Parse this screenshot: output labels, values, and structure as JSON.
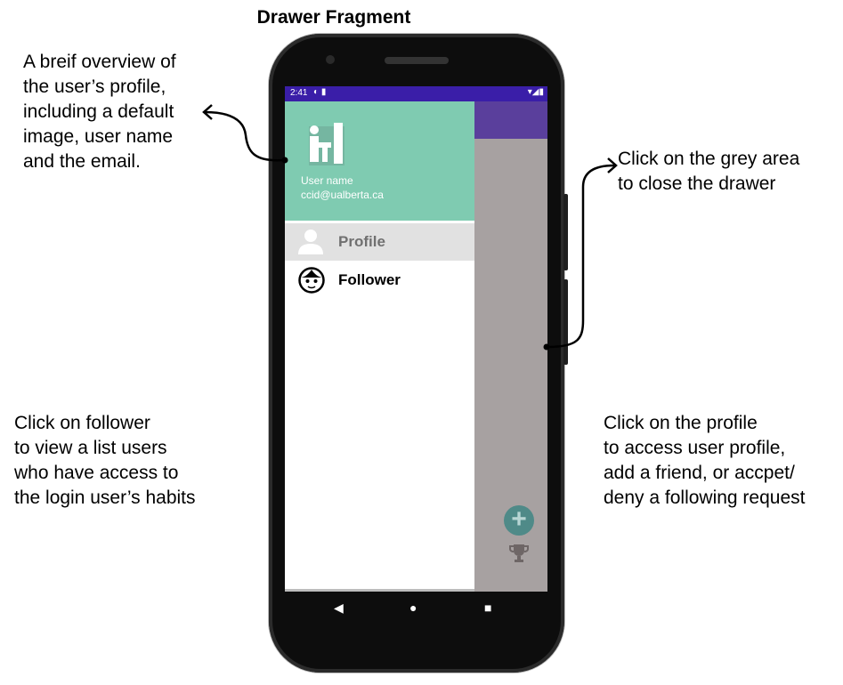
{
  "title": "Drawer Fragment",
  "annotations": {
    "top_left": "A breif overview of\nthe user’s profile,\nincluding a default\nimage, user name\nand the email.",
    "top_right": "Click on the grey area\nto close the drawer",
    "bottom_left": "Click on follower\nto view a list users\nwho have access to\nthe login user’s habits",
    "bottom_right": "Click on the profile\nto access user profile,\nadd a friend, or accpet/\ndeny a following request"
  },
  "status_bar": {
    "time": "2:41",
    "left_icons": "◐ ▮",
    "right_icons": "▾◢▮"
  },
  "drawer": {
    "user_name": "User name",
    "email": "ccid@ualberta.ca",
    "menu": [
      {
        "label": "Profile",
        "icon": "person-icon",
        "selected": true
      },
      {
        "label": "Follower",
        "icon": "face-icon",
        "selected": false
      }
    ]
  },
  "fab_symbol": "+",
  "nav": {
    "back": "◀",
    "home": "●",
    "recents": "■"
  },
  "colors": {
    "status_bar": "#3a1ea8",
    "app_bar": "#5a3f9c",
    "drawer_header": "#7fcbb1",
    "scrim": "#a7a1a1",
    "fab": "#4f8a88",
    "selected_item": "#e1e1e1"
  }
}
